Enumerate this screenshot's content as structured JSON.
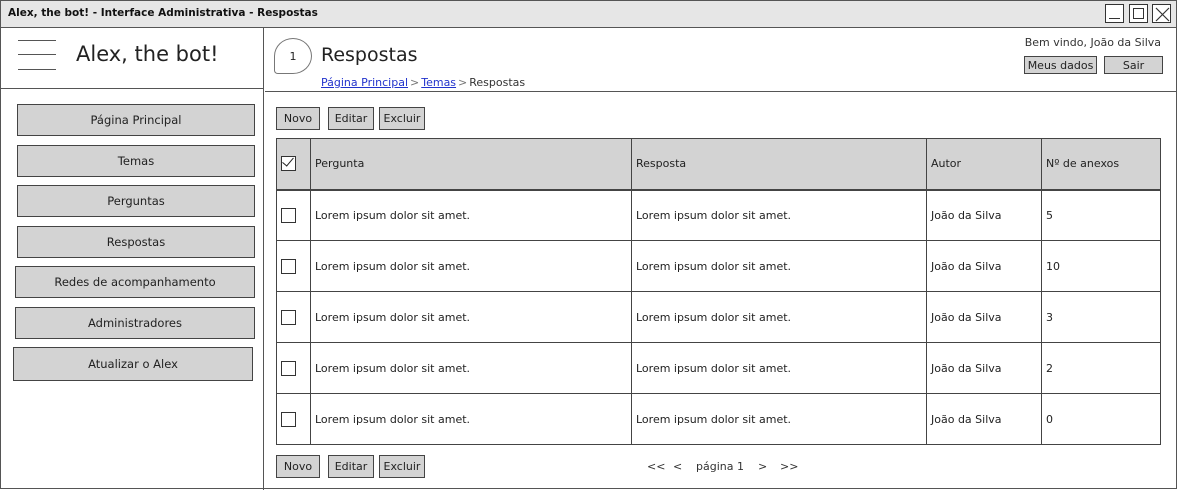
{
  "window": {
    "title": "Alex, the bot! - Interface Administrativa - Respostas"
  },
  "sidebar": {
    "app_name": "Alex, the bot!",
    "items": [
      {
        "label": "Página Principal"
      },
      {
        "label": "Temas"
      },
      {
        "label": "Perguntas"
      },
      {
        "label": "Respostas"
      },
      {
        "label": "Redes de acompanhamento"
      },
      {
        "label": "Administradores"
      },
      {
        "label": "Atualizar o Alex"
      }
    ]
  },
  "header": {
    "badge": "1",
    "title": "Respostas",
    "breadcrumb": [
      {
        "label": "Página Principal",
        "link": true
      },
      {
        "label": "Temas",
        "link": true
      },
      {
        "label": "Respostas",
        "link": false
      }
    ],
    "breadcrumb_sep": ">",
    "welcome": "Bem vindo, João da Silva",
    "my_data_label": "Meus dados",
    "logout_label": "Sair"
  },
  "actions": {
    "new": "Novo",
    "edit": "Editar",
    "delete": "Excluir"
  },
  "table": {
    "columns": [
      "Pergunta",
      "Resposta",
      "Autor",
      "Nº de anexos"
    ],
    "rows": [
      {
        "pergunta": "Lorem ipsum dolor sit amet.",
        "resposta": "Lorem ipsum dolor sit amet.",
        "autor": "João da Silva",
        "anexos": "5"
      },
      {
        "pergunta": "Lorem ipsum dolor sit amet.",
        "resposta": "Lorem ipsum dolor sit amet.",
        "autor": "João da Silva",
        "anexos": "10"
      },
      {
        "pergunta": "Lorem ipsum dolor sit amet.",
        "resposta": "Lorem ipsum dolor sit amet.",
        "autor": "João da Silva",
        "anexos": "3"
      },
      {
        "pergunta": "Lorem ipsum dolor sit amet.",
        "resposta": "Lorem ipsum dolor sit amet.",
        "autor": "João da Silva",
        "anexos": "2"
      },
      {
        "pergunta": "Lorem ipsum dolor sit amet.",
        "resposta": "Lorem ipsum dolor sit amet.",
        "autor": "João da Silva",
        "anexos": "0"
      }
    ]
  },
  "pagination": {
    "first": "<<",
    "prev": "<",
    "label": "página 1",
    "next": ">",
    "last": ">>"
  }
}
